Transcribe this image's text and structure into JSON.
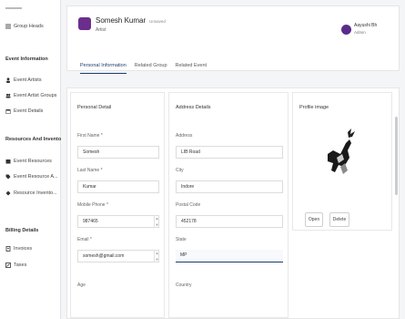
{
  "sidebar": {
    "items": [
      {
        "label": "Group Heads",
        "icon": "list-icon"
      },
      {
        "label": "Event Information",
        "header": true
      },
      {
        "label": "Event Artists",
        "icon": "user-icon"
      },
      {
        "label": "Event Artist Groups",
        "icon": "users-icon"
      },
      {
        "label": "Event Details",
        "icon": "calendar-icon"
      },
      {
        "label": "Resources And Inventory",
        "header": true
      },
      {
        "label": "Event Resources",
        "icon": "box-icon"
      },
      {
        "label": "Event Resource A...",
        "icon": "tag-icon"
      },
      {
        "label": "Resource Invento...",
        "icon": "pin-icon"
      },
      {
        "label": "Billing Details",
        "header": true
      },
      {
        "label": "Invoices",
        "icon": "receipt-icon"
      },
      {
        "label": "Taxes",
        "icon": "percent-icon"
      }
    ]
  },
  "profile": {
    "name": "Somesh Kumar",
    "status": "Unsaved",
    "subtitle": "Artist"
  },
  "user": {
    "name": "Aayushi Bh",
    "role": "Admin"
  },
  "tabs": [
    "Personal Information",
    "Related Group",
    "Related Event"
  ],
  "personal": {
    "title": "Personal Detail",
    "first_name_label": "First Name *",
    "first_name": "Somesh",
    "last_name_label": "Last Name *",
    "last_name": "Kumar",
    "mobile_label": "Mobile Phone *",
    "mobile": "987465",
    "email_label": "Email *",
    "email": "somesh@gmail.com",
    "age_label": "Age"
  },
  "address": {
    "title": "Address Details",
    "address_label": "Address",
    "address": "LIB Road",
    "city_label": "City",
    "city": "Indore",
    "postal_label": "Postal Code",
    "postal": "452178",
    "state_label": "State",
    "state": "MP",
    "country_label": "Country"
  },
  "photo_card": {
    "title": "Profile image",
    "open_label": "Open",
    "delete_label": "Delete"
  },
  "colors": {
    "accent": "#1b3d6e",
    "avatar": "#6b2e8c"
  }
}
